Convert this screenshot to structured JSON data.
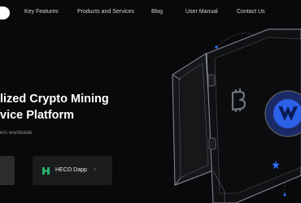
{
  "nav": {
    "items": [
      "Key Features",
      "Products and Services",
      "Blog",
      "User Manual",
      "Contact Us"
    ]
  },
  "hero": {
    "title_line1": "lized Crypto Mining",
    "title_line2": "vice Platform",
    "subtitle": "ers worldwide"
  },
  "buttons": {
    "heco_label": "HECO Dapp",
    "heco_arrow": "›"
  },
  "colors": {
    "background": "#08090a",
    "accent_blue": "#2f6bff",
    "heco_green": "#29b26e"
  },
  "icons": [
    "bitcoin-icon",
    "brand-logo-icon",
    "heco-logo-icon",
    "chevron-right-icon",
    "star-icon"
  ]
}
